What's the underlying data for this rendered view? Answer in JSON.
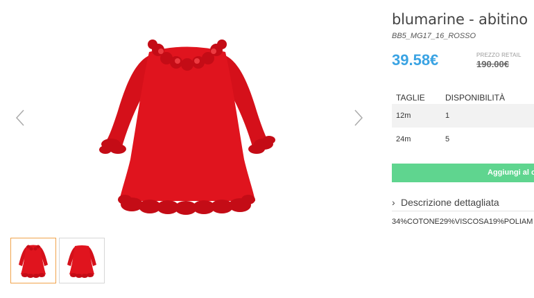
{
  "gallery": {
    "prev_icon": "chevron-left-icon",
    "next_icon": "chevron-right-icon",
    "product_color": "#e0141e",
    "thumb_active_border": "#f0a24a"
  },
  "product": {
    "title": "blumarine - abitino",
    "sku": "BB5_MG17_16_ROSSO",
    "price": "39.58€",
    "retail_label": "PREZZO RETAIL",
    "retail_price": "190.00€",
    "price_color": "#3aa3e3"
  },
  "sizes": {
    "headers": [
      "TAGLIE",
      "DISPONIBILITÀ"
    ],
    "rows": [
      {
        "size": "12m",
        "availability": "1"
      },
      {
        "size": "24m",
        "availability": "5"
      }
    ]
  },
  "cart": {
    "button_label": "Aggiungi al ca",
    "button_color": "#5fd58f"
  },
  "description": {
    "toggle_icon": "chevron-right-icon",
    "toggle_label": "Descrizione dettagliata",
    "composition": "34%COTONE29%VISCOSA19%POLIAM"
  }
}
